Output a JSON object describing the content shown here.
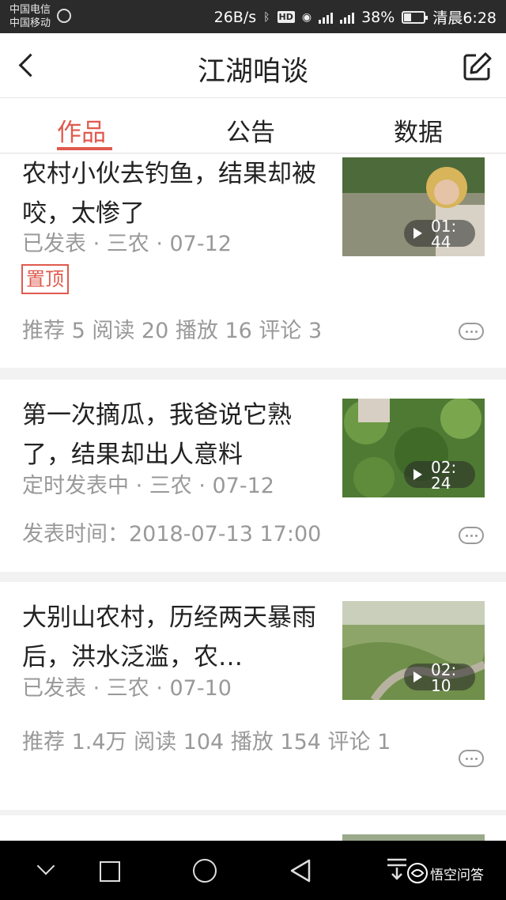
{
  "status_bar": {
    "carrier_1": "中国电信",
    "carrier_2": "中国移动",
    "net_speed": "26B/s",
    "hd_label": "HD",
    "battery_percent": "38%",
    "battery_level": 0.38,
    "time": "清晨6:28",
    "icons": [
      "brightness-icon",
      "bluetooth-icon",
      "eye-icon",
      "signal-icon",
      "battery-icon"
    ]
  },
  "header": {
    "title": "江湖咱谈",
    "back_icon": "chevron-left-icon",
    "edit_icon": "edit-icon"
  },
  "tabs": [
    {
      "label": "作品",
      "active": true
    },
    {
      "label": "公告",
      "active": false
    },
    {
      "label": "数据",
      "active": false
    }
  ],
  "posts": [
    {
      "title": "农村小伙去钓鱼，结果却被咬，太惨了",
      "meta": "已发表 · 三农 · 07-12",
      "badge": "置顶",
      "duration": "01:44",
      "stats": "推荐 5   阅读 20   播放 16   评论 3"
    },
    {
      "title": "第一次摘瓜，我爸说它熟了，结果却出人意料",
      "meta": "定时发表中 · 三农 · 07-12",
      "duration": "02:24",
      "stats": "发表时间：2018-07-13 17:00"
    },
    {
      "title": "大别山农村，历经两天暴雨后，洪水泛滥，农…",
      "meta": "已发表 · 三农 · 07-10",
      "duration": "02:10",
      "stats": "推荐 1.4万   阅读 104   播放 154   评论 1"
    }
  ],
  "watermark": "悟空问答",
  "colors": {
    "accent": "#e05a4e",
    "status_bar_bg": "#2b2b2b",
    "nav_bar_bg": "#000000",
    "meta_text": "#999999"
  }
}
